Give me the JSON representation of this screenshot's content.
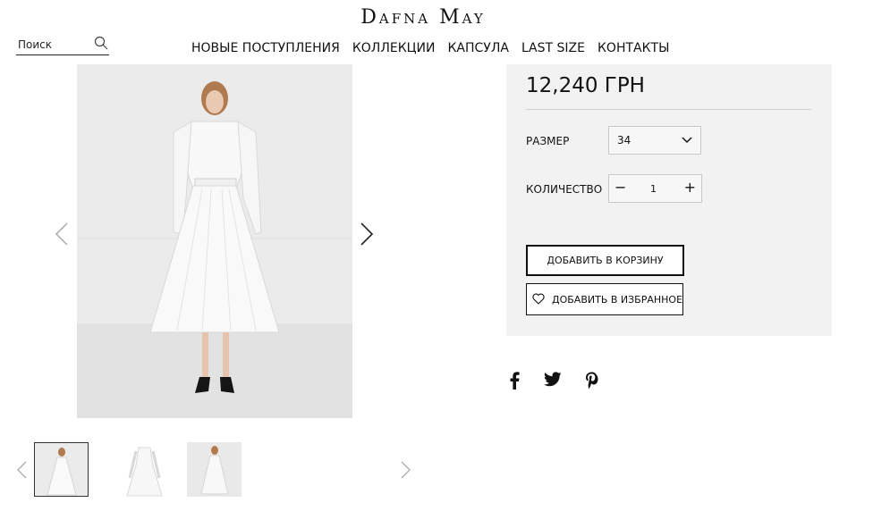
{
  "brand": {
    "logo_text": "Dafna May"
  },
  "search": {
    "placeholder": "Поиск"
  },
  "nav": {
    "items": [
      {
        "label": "НОВЫЕ ПОСТУПЛЕНИЯ"
      },
      {
        "label": "КОЛЛЕКЦИИ"
      },
      {
        "label": "КАПСУЛА"
      },
      {
        "label": "LAST SIZE"
      },
      {
        "label": "КОНТАКТЫ"
      }
    ]
  },
  "gallery": {
    "thumbnail_count": 3,
    "active_thumbnail": 1
  },
  "product": {
    "price": "12,240 ГРН",
    "size_label": "РАЗМЕР",
    "size_value": "34",
    "quantity_label": "КОЛИЧЕСТВО",
    "quantity_minus": "−",
    "quantity_value": "1",
    "quantity_plus": "+",
    "add_to_cart_label": "ДОБАВИТЬ В КОРЗИНУ",
    "add_to_favorites_label": "ДОБАВИТЬ В ИЗБРАННОЕ"
  },
  "social": {
    "icons": [
      "facebook-icon",
      "twitter-icon",
      "pinterest-icon"
    ]
  },
  "colors": {
    "panel_bg": "#f2f2f2",
    "text": "#111111",
    "photo_bg": "#ececec"
  }
}
